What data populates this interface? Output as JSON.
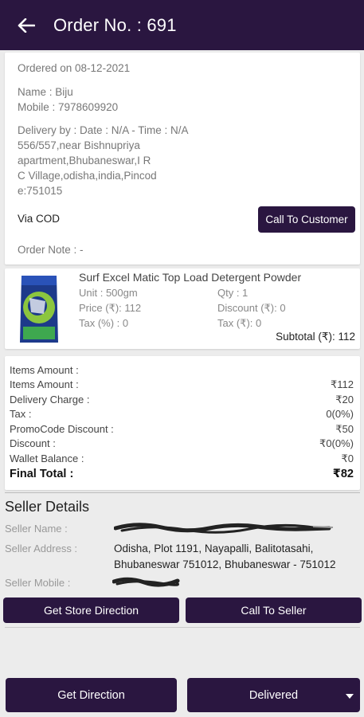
{
  "header": {
    "title": "Order No. : 691",
    "back_icon": "back-arrow-icon"
  },
  "order": {
    "ordered_on": "Ordered on 08-12-2021",
    "name": "Name : Biju",
    "mobile": "Mobile : 7978609920",
    "delivery": "Delivery by : Date : N/A - Time : N/A",
    "address": [
      "556/557,near Bishnupriya",
      "apartment,Bhubaneswar,I R",
      "C Village,odisha,india,Pincod",
      "e:751015"
    ],
    "payment": "Via COD",
    "call_customer_label": "Call To Customer",
    "note": "Order Note : -"
  },
  "product": {
    "name": "Surf Excel Matic Top Load Detergent Powder",
    "unit": "Unit : 500gm",
    "qty": "Qty : 1",
    "price": "Price (₹): 112",
    "discount": "Discount (₹): 0",
    "tax_percent": "Tax (%) : 0",
    "tax_amount": "Tax (₹): 0",
    "subtotal": "Subtotal (₹): 112"
  },
  "summary": {
    "rows": [
      {
        "label": "Items Amount :",
        "value": ""
      },
      {
        "label": "Items Amount :",
        "value": "₹112"
      },
      {
        "label": "Delivery Charge :",
        "value": "₹20"
      },
      {
        "label": "Tax :",
        "value": "0(0%)"
      },
      {
        "label": "PromoCode Discount :",
        "value": "₹50"
      },
      {
        "label": "Discount :",
        "value": "₹0(0%)"
      },
      {
        "label": "Wallet Balance :",
        "value": "₹0"
      }
    ],
    "final_label": "Final Total :",
    "final_value": "₹82"
  },
  "seller": {
    "title": "Seller Details",
    "name_label": "Seller Name :",
    "address_label": "Seller Address :",
    "address": [
      "Odisha, Plot 1191, Nayapalli, Balitotasahi,",
      "Bhubaneswar 751012, Bhubaneswar - 751012"
    ],
    "mobile_label": "Seller Mobile :",
    "store_direction_label": "Get Store Direction",
    "call_seller_label": "Call To Seller"
  },
  "footer": {
    "get_direction_label": "Get Direction",
    "status_label": "Delivered"
  },
  "colors": {
    "primary": "#2a1640",
    "background": "#ececec",
    "card": "#ffffff"
  }
}
